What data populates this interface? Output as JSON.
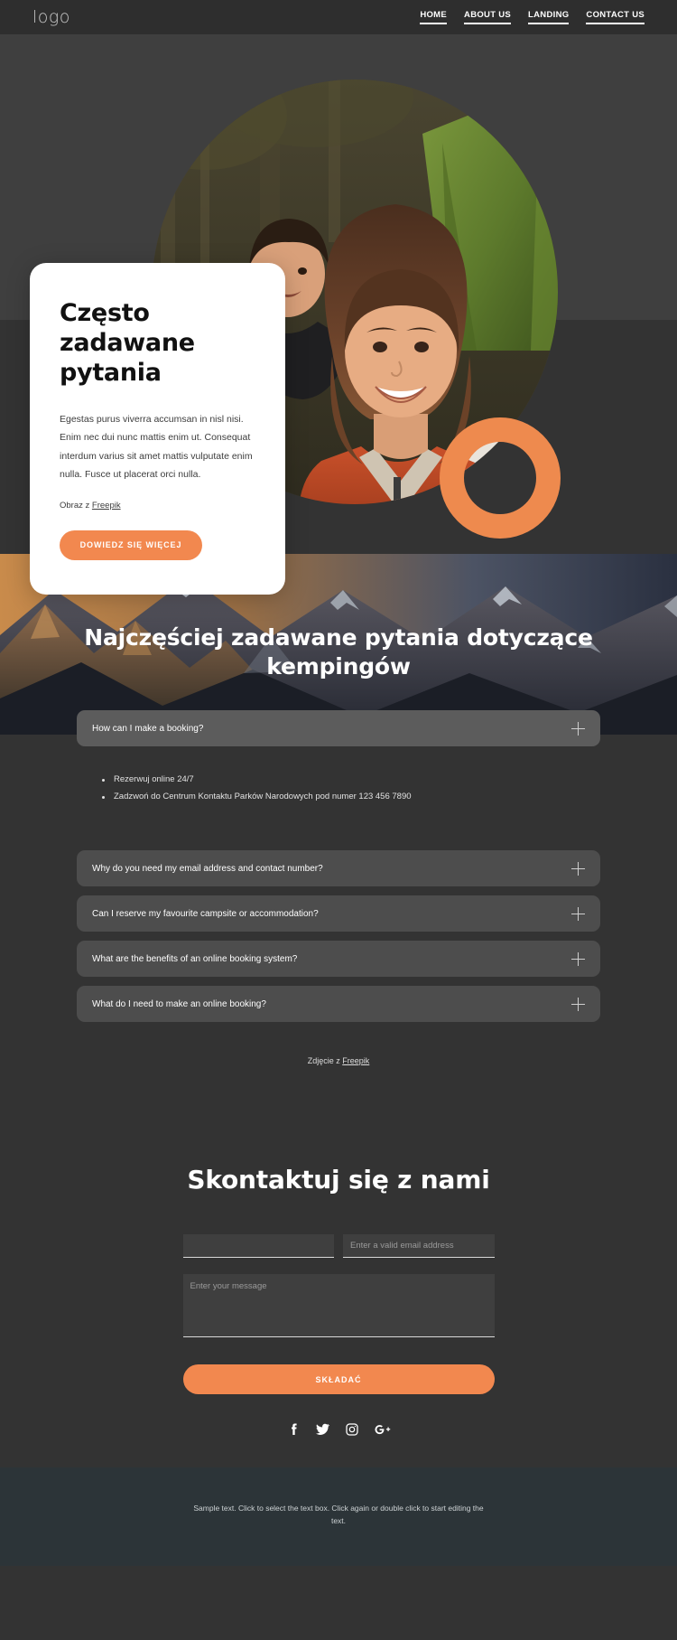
{
  "header": {
    "logo": "logo",
    "nav": [
      {
        "label": "HOME"
      },
      {
        "label": "ABOUT US"
      },
      {
        "label": "LANDING"
      },
      {
        "label": "CONTACT US"
      }
    ]
  },
  "hero": {
    "card": {
      "title": "Często zadawane pytania",
      "body": "Egestas purus viverra accumsan in nisl nisi. Enim nec dui nunc mattis enim ut. Consequat interdum varius sit amet mattis vulputate enim nulla. Fusce ut placerat orci nulla.",
      "credit_prefix": "Obraz z ",
      "credit_link": "Freepik",
      "cta_label": "DOWIEDZ SIĘ WIĘCEJ"
    }
  },
  "faq": {
    "heading": "Najczęściej zadawane pytania dotyczące kempingów",
    "items": [
      {
        "question": "How can I make a booking?",
        "open": true,
        "answers": [
          "Rezerwuj online 24/7",
          "Zadzwoń do Centrum Kontaktu Parków Narodowych pod numer 123 456 7890"
        ]
      },
      {
        "question": "Why do you need my email address and contact number?",
        "open": false,
        "answers": []
      },
      {
        "question": "Can I reserve my favourite campsite or accommodation?",
        "open": false,
        "answers": []
      },
      {
        "question": "What are the benefits of an online booking system?",
        "open": false,
        "answers": []
      },
      {
        "question": "What do I need to make an online booking?",
        "open": false,
        "answers": []
      }
    ],
    "credit_prefix": "Zdjęcie z ",
    "credit_link": "Freepik"
  },
  "contact": {
    "title": "Skontaktuj się z nami",
    "name_value": "",
    "name_placeholder": "",
    "email_value": "",
    "email_placeholder": "Enter a valid email address",
    "message_value": "",
    "message_placeholder": "Enter your message",
    "submit_label": "SKŁADAĆ",
    "socials": [
      {
        "name": "facebook"
      },
      {
        "name": "twitter"
      },
      {
        "name": "instagram"
      },
      {
        "name": "google-plus"
      }
    ]
  },
  "footer": {
    "text": "Sample text. Click to select the text box. Click again or double click to start editing the text."
  },
  "colors": {
    "accent": "#f2884f",
    "page_bg": "#333333",
    "header_bg": "#2e2e2e",
    "accordion_open": "#5c5c5c",
    "accordion_closed": "#4d4d4d",
    "footer_bg": "#2c3438"
  }
}
